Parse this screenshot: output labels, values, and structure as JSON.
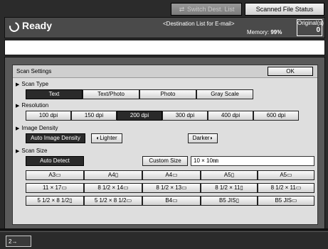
{
  "top": {
    "switch_dest": "Switch Dest. List",
    "scanned_status": "Scanned File Status"
  },
  "status": {
    "ready": "Ready",
    "dest_list": "<Destination List for E-mail>",
    "memory_label": "Memory:",
    "memory_value": "99%",
    "originals_label": "Original(s)",
    "originals_count": "0"
  },
  "dialog": {
    "title": "Scan Settings",
    "ok": "OK",
    "scan_type": {
      "label": "Scan Type",
      "options": [
        "Text",
        "Text/Photo",
        "Photo",
        "Gray Scale"
      ],
      "selected": "Text"
    },
    "resolution": {
      "label": "Resolution",
      "options": [
        "100 dpi",
        "150 dpi",
        "200 dpi",
        "300 dpi",
        "400 dpi",
        "600 dpi"
      ],
      "selected": "200 dpi"
    },
    "density": {
      "label": "Image Density",
      "auto": "Auto Image Density",
      "lighter": "Lighter",
      "darker": "Darker"
    },
    "scan_size": {
      "label": "Scan Size",
      "auto_detect": "Auto Detect",
      "custom_size": "Custom Size",
      "custom_value": "10 × 10㎜",
      "sizes": [
        "A3▭",
        "A4▯",
        "A4▭",
        "A5▯",
        "A5▭",
        "11 × 17▭",
        "8 1/2 × 14▭",
        "8 1/2 × 13▭",
        "8 1/2 × 11▯",
        "8 1/2 × 11▭",
        "5 1/2 × 8 1/2▯",
        "5 1/2 × 8 1/2▭",
        "B4▭",
        "B5 JIS▯",
        "B5 JIS▭"
      ]
    }
  },
  "bottom": {
    "tray_label": "2→"
  }
}
